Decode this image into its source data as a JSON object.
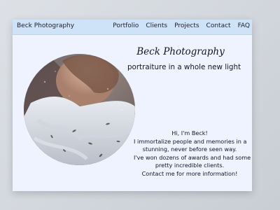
{
  "header": {
    "brand": "Beck Photography",
    "nav": [
      "Portfolio",
      "Clients",
      "Projects",
      "Contact",
      "FAQ"
    ]
  },
  "hero": {
    "title": "Beck Photography",
    "subtitle": "portraiture in a whole new light"
  },
  "intro": {
    "lines": [
      "Hi, I'm Beck!",
      "I immortalize people and memories in a",
      "stunning, never before seen way.",
      "I've won dozens of awards and had some",
      "pretty incredible clients.",
      "Contact me for more information!"
    ]
  },
  "colors": {
    "header_bg": "#cfe3f8",
    "page_bg": "#eef3ff",
    "text": "#15151f"
  }
}
